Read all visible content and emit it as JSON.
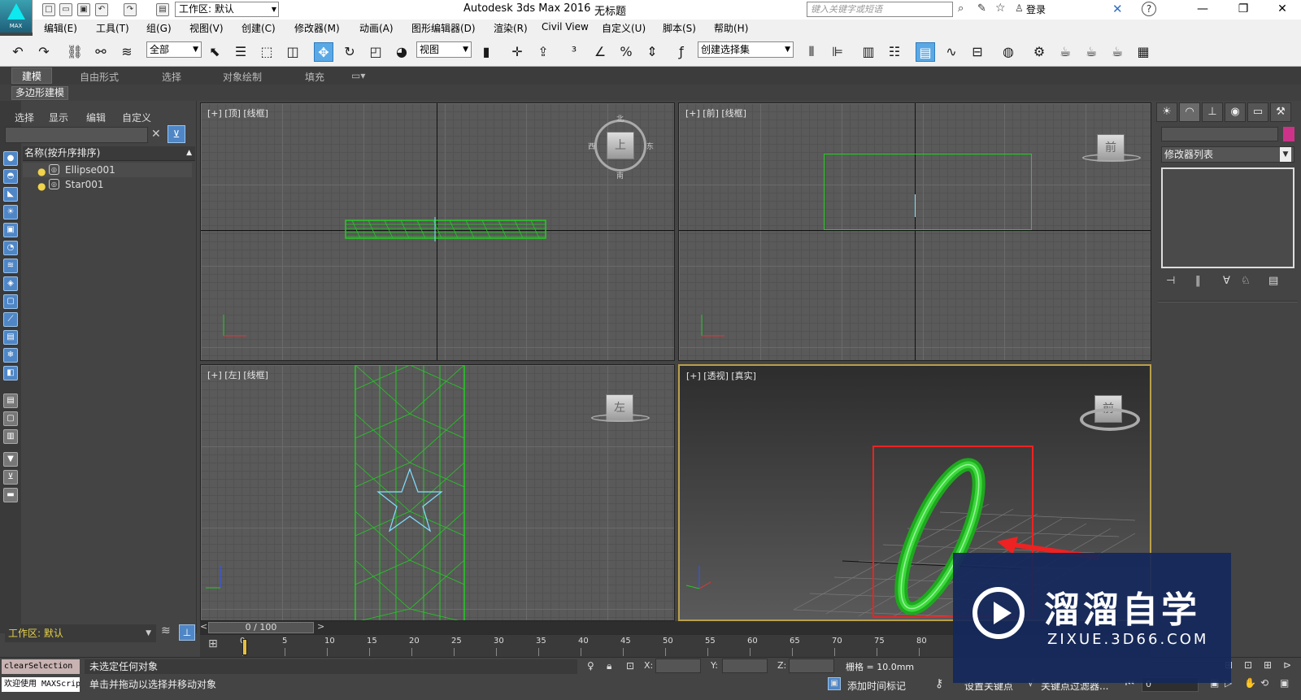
{
  "titlebar": {
    "app_title": "Autodesk 3ds Max 2016",
    "doc_title": "无标题",
    "workspace": "工作区: 默认",
    "search_placeholder": "键入关键字或短语",
    "login": "登录",
    "logo_text": "MAX",
    "help_icon": "?"
  },
  "menu": [
    "编辑(E)",
    "工具(T)",
    "组(G)",
    "视图(V)",
    "创建(C)",
    "修改器(M)",
    "动画(A)",
    "图形编辑器(D)",
    "渲染(R)",
    "Civil View",
    "自定义(U)",
    "脚本(S)",
    "帮助(H)"
  ],
  "toolbar": {
    "selection_filter": "全部",
    "ref_coord": "视图",
    "named_selection": "创建选择集"
  },
  "ribbon": {
    "tabs": [
      "建模",
      "自由形式",
      "选择",
      "对象绘制",
      "填充"
    ],
    "active_tab": "建模",
    "sub_label": "多边形建模"
  },
  "scene_explorer": {
    "menus": [
      "选择",
      "显示",
      "编辑",
      "自定义"
    ],
    "header": "名称(按升序排序)",
    "objects": [
      "Ellipse001",
      "Star001"
    ],
    "workspace": "工作区: 默认"
  },
  "viewports": {
    "top": "[+] [顶] [线框]",
    "front": "[+] [前] [线框]",
    "left": "[+] [左] [线框]",
    "persp": "[+] [透视] [真实]",
    "cube_top": "上",
    "cube_front": "前",
    "cube_left": "左",
    "cube_persp": "前",
    "compass_n": "北",
    "compass_s": "南",
    "compass_e": "东",
    "compass_w": "西"
  },
  "command_panel": {
    "modifier_list": "修改器列表"
  },
  "timeline": {
    "current": "0 / 100",
    "ticks": [
      "0",
      "5",
      "10",
      "15",
      "20",
      "25",
      "30",
      "35",
      "40",
      "45",
      "50",
      "55",
      "60",
      "65",
      "70",
      "75",
      "80"
    ]
  },
  "status": {
    "maxscript_top": "clearSelection",
    "maxscript_bottom": "欢迎使用 MAXScript",
    "selection": "未选定任何对象",
    "prompt": "单击并拖动以选择并移动对象",
    "x_label": "X:",
    "y_label": "Y:",
    "z_label": "Z:",
    "grid": "栅格 = 10.0mm",
    "add_time_tag": "添加时间标记",
    "set_key": "设置关键点",
    "key_filters": "关键点过滤器...",
    "frame": "0"
  },
  "watermark": {
    "cn": "溜溜自学",
    "en": "ZIXUE.3D66.COM"
  },
  "colors": {
    "accent": "#5aa9e6",
    "wire_green": "#22cc22",
    "star_cyan": "#7fe0ff",
    "highlight_red": "#ee2222",
    "viewport_active": "#b9a04a"
  }
}
